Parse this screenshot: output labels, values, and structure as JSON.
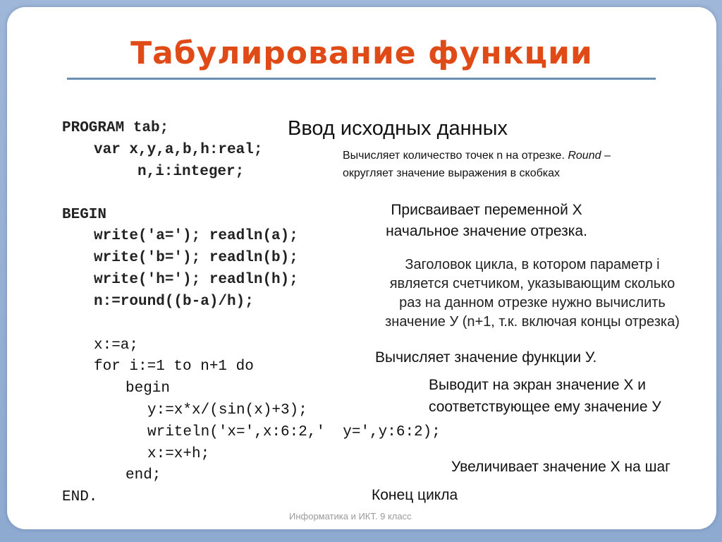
{
  "slide": {
    "title": "Табулирование функции",
    "footer": "Информатика и ИКТ. 9 класс",
    "accent_color": "#e04a17",
    "code_lines": [
      "PROGRAM tab;",
      "var x,y,a,b,h:real;",
      "n,i:integer;",
      "BEGIN",
      "write('a='); readln(a);",
      "write('b='); readln(b);",
      "write('h='); readln(h);",
      "n:=round((b-a)/h);",
      "x:=a;",
      "for i:=1 to n+1 do",
      "begin",
      "y:=x*x/(sin(x)+3);",
      "writeln('x=',x:6:2,'  y=',y:6:2);",
      "x:=x+h;",
      "end;",
      "END."
    ],
    "annotations": {
      "input_data": "Ввод исходных  данных",
      "round_line1": "Вычисляет  количество точек n  на отрезке. ",
      "round_italic": "Round",
      "round_dash": " –",
      "round_line2": "округляет значение  выражения  в скобках",
      "assign_x_line1": "Присваивает переменной Х",
      "assign_x_line2": "начальное значение отрезка.",
      "loop_header_line1": "Заголовок цикла, в котором параметр i",
      "loop_header_line2": "является счетчиком, указывающим сколько",
      "loop_header_line3": "раз на данном отрезке нужно вычислить",
      "loop_header_line4": "значение У (n+1, т.к. включая концы отрезка)",
      "compute_y": "Вычисляет значение функции У.",
      "output_line1": "Выводит на экран значение Х и",
      "output_line2": "соответствующее ему значение У",
      "increment_x": "Увеличивает значение Х на шаг",
      "loop_end": "Конец цикла"
    }
  }
}
